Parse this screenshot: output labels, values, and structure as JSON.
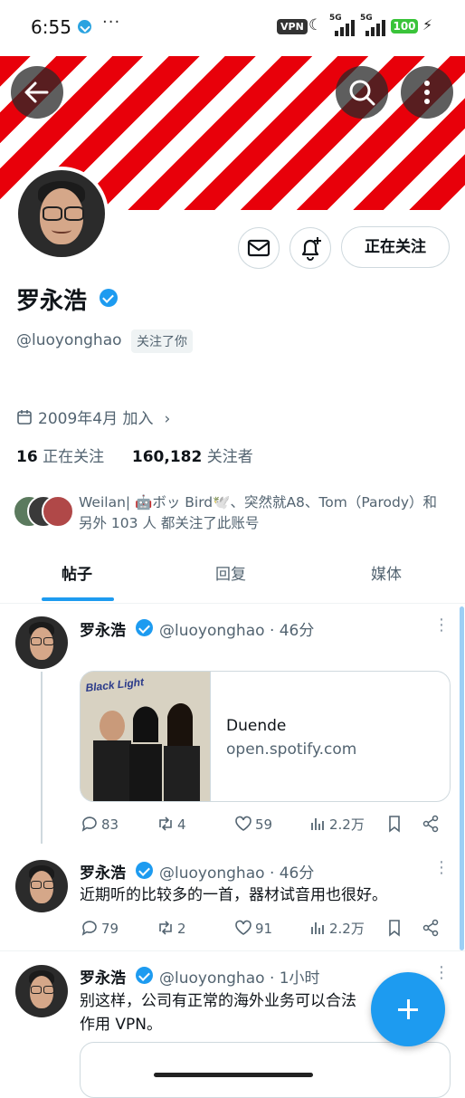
{
  "status_bar": {
    "time": "6:55",
    "dots": "···",
    "vpn": "VPN",
    "net1": "5G",
    "net2": "5G",
    "battery": "100"
  },
  "profile": {
    "name": "罗永浩",
    "handle": "@luoyonghao",
    "follows_you": "关注了你",
    "follow_button": "正在关注",
    "joined": "2009年4月 加入",
    "following_count": "16",
    "following_label": "正在关注",
    "followers_count": "160,182",
    "followers_label": "关注者",
    "followed_by_line1": "Weilan| 🤖ボッ Bird🕊️、突然就A8、Tom（Parody）和",
    "followed_by_line2": "另外 103 人 都关注了此账号"
  },
  "tabs": [
    "帖子",
    "回复",
    "媒体"
  ],
  "posts": [
    {
      "name": "罗永浩",
      "handle": "@luoyonghao",
      "time": "· 46分",
      "text": "",
      "card_title": "Duende",
      "card_domain": "open.spotify.com",
      "replies": "83",
      "retweets": "4",
      "likes": "59",
      "views": "2.2万"
    },
    {
      "name": "罗永浩",
      "handle": "@luoyonghao",
      "time": "· 46分",
      "text": "近期听的比较多的一首，器材试音用也很好。",
      "replies": "79",
      "retweets": "2",
      "likes": "91",
      "views": "2.2万"
    },
    {
      "name": "罗永浩",
      "handle": "@luoyonghao",
      "time": "· 1小时",
      "text_line1": "别这样，公司有正常的海外业务可以合法",
      "text_line2": "作用 VPN。"
    }
  ],
  "icons": {
    "back": "arrow-left-icon",
    "search": "search-icon",
    "more": "more-vertical-icon",
    "mail": "mail-icon",
    "bell": "bell-plus-icon",
    "compose": "plus-icon"
  },
  "colors": {
    "accent": "#1d9bf0",
    "banner_red": "#e8000a"
  }
}
